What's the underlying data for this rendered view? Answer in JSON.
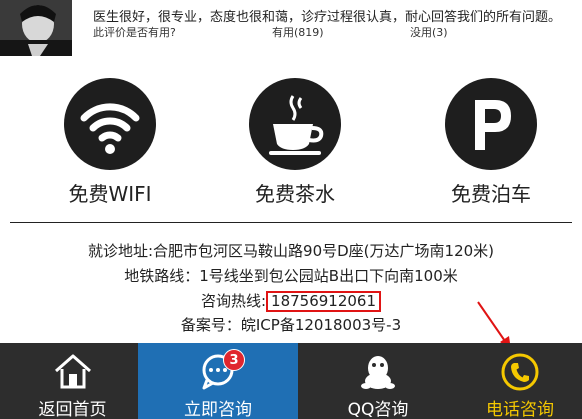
{
  "review": {
    "text": "医生很好，很专业，态度也很和蔼，诊疗过程很认真，耐心回答我们的所有问题。",
    "question": "此评价是否有用?",
    "useful": "有用(819)",
    "useless": "没用(3)"
  },
  "features": [
    {
      "icon": "wifi-icon",
      "label": "免费WIFI"
    },
    {
      "icon": "tea-cup-icon",
      "label": "免费茶水"
    },
    {
      "icon": "parking-icon",
      "label": "免费泊车"
    }
  ],
  "info": {
    "address": "就诊地址:合肥市包河区马鞍山路90号D座(万达广场南120米)",
    "subway": "地铁路线：1号线坐到包公园站B出口下向南100米",
    "hotline_label": "咨询热线:",
    "hotline_number": "18756912061",
    "icp": "备案号：皖ICP备12018003号-3"
  },
  "nav": {
    "home": "返回首页",
    "consult": "立即咨询",
    "consult_badge": "3",
    "qq": "QQ咨询",
    "phone": "电话咨询"
  },
  "colors": {
    "nav_bg": "#2d2d2d",
    "nav_active": "#1f6fb4",
    "phone_accent": "#f5c800",
    "badge": "#e0262e",
    "highlight_box": "#e01414"
  }
}
